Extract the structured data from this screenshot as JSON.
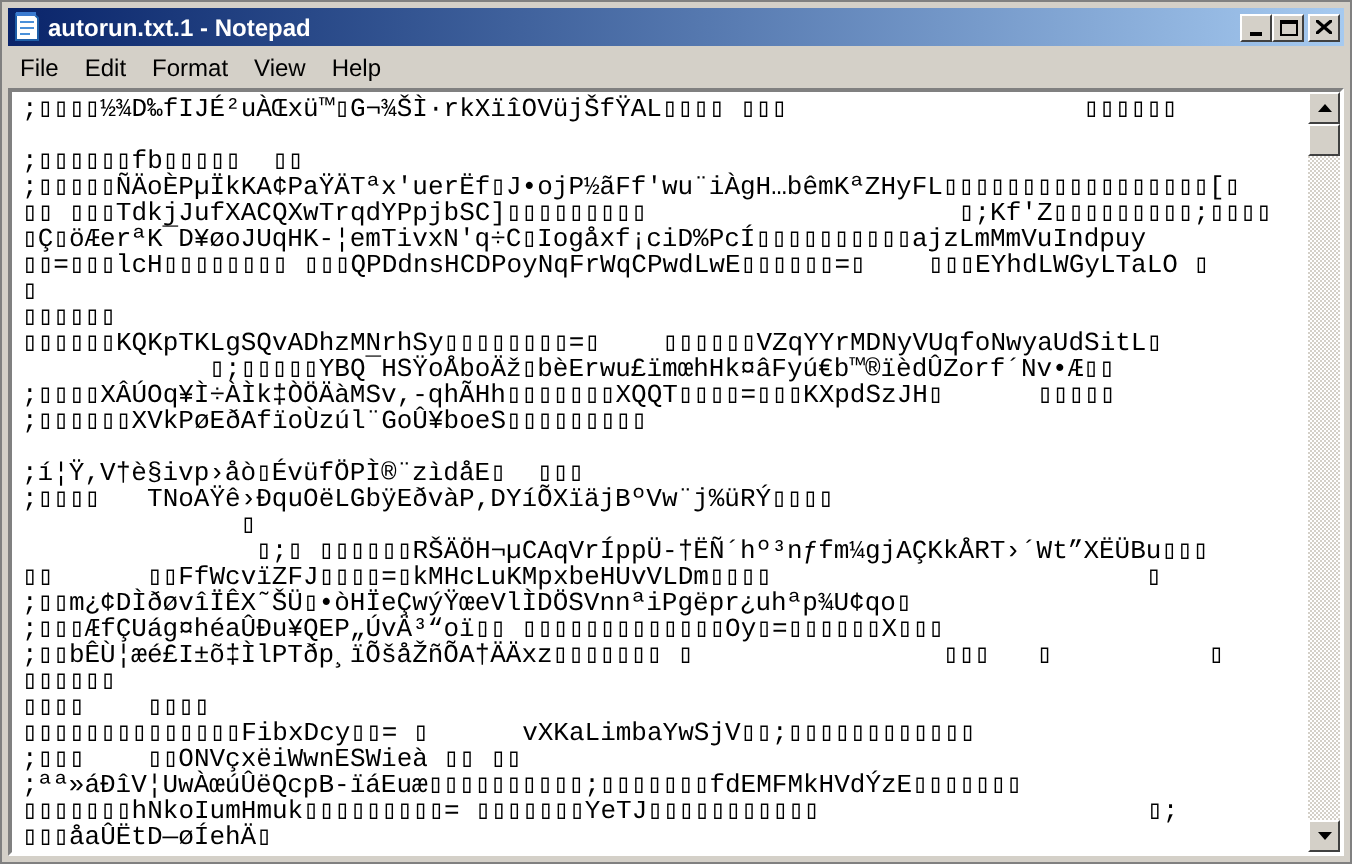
{
  "window": {
    "title": "autorun.txt.1 - Notepad"
  },
  "menu": [
    "File",
    "Edit",
    "Format",
    "View",
    "Help"
  ],
  "document": {
    "blocks": [
      [
        ";▯▯▯▯½¾D‰fIJÉ²uÀŒxü™▯G¬¾ŠÌ·rkXïîOVüjŠfŸAL▯▯▯▯ ▯▯▯                   ▯▯▯▯▯▯"
      ],
      [
        ";▯▯▯▯▯▯fb▯▯▯▯▯  ▯▯",
        ";▯▯▯▯▯ÑÄoÈPµÏkKA¢PaŸÄTªx'uerËf▯J•ojP½ãFf'wu¨iÀgH…bêmKªZHyFL▯▯▯▯▯▯▯▯▯▯▯▯▯▯▯▯▯[▯",
        "▯▯ ▯▯▯TdkjJufXACQXwTrqdYPpjbSC]▯▯▯▯▯▯▯▯▯                    ▯;Kf'Z▯▯▯▯▯▯▯▯▯;▯▯▯▯",
        "▯Ç▯öÆerªK¯D¥øoJUqHK-¦emTivxN'q÷C▯Iogåxf¡ciD%PcÍ▯▯▯▯▯▯▯▯▯▯ajzLmMmVuIndpuy",
        "▯▯=▯▯▯lcH▯▯▯▯▯▯▯▯ ▯▯▯QPDdnsHCDPoyNqFrWqCPwdLwE▯▯▯▯▯▯=▯    ▯▯▯EYhdLWGyLTaLO ▯",
        "▯",
        "▯▯▯▯▯▯",
        "▯▯▯▯▯▯KQKpTKLgSQvADhzMNrhSy▯▯▯▯▯▯▯▯=▯    ▯▯▯▯▯▯VZqYYrMDNyVUqfoNwyaUdSitL▯",
        "            ▯;▯▯▯▯▯YBQ¯HSŸoÅboÄž▯bèErwu£ïmœhHk¤âFyú€b™®ïèdÛZorf´Nv•Æ▯▯",
        ";▯▯▯▯XÂÚOq¥Ì÷ÀÌk‡ÒÖÄàMSv,-qhÃHh▯▯▯▯▯▯▯XQQT▯▯▯▯=▯▯▯KXpdSzJH▯      ▯▯▯▯▯",
        ";▯▯▯▯▯▯XVkPøEðAfïoÙzúl¨GoÛ¥boeS▯▯▯▯▯▯▯▯▯"
      ],
      [
        ";í¦Ÿ,V†è§ivp›åò▯ÉvüfÖPÌ®¨zìdåE▯  ▯▯▯",
        ";▯▯▯▯   TNoAŸê›ÐquOëLGbÿEðvàP,DYíÕXïäjBºVw¨j%üRÝ▯▯▯▯",
        "              ▯",
        "               ▯;▯ ▯▯▯▯▯▯RŠÄÖH¬µCAqVrÍppÜ-†ËÑ´hº³nƒfm¼gjAÇKkÅRT›´Wt”XËÜBu▯▯▯",
        "▯▯      ▯▯FfWcvïZFJ▯▯▯▯=▯kMHcLuKMpxbeHUvVLDm▯▯▯▯                        ▯",
        ";▯▯m¿¢DÌðøvîÏÊX˜ŠÜ▯•òHÏeÇwýŸœeVlÌDÖSVnnªiPgëpr¿uhªp¾U¢qo▯",
        ";▯▯▯ÆfÇUág¤héaÛÐu¥QEP„ÚvÄ³“oï▯▯ ▯▯▯▯▯▯▯▯▯▯▯▯▯Oy▯=▯▯▯▯▯▯X▯▯▯",
        ";▯▯bÊÙ¦æé£I±õ‡ÌlPTðp¸ïÕšåŽñÕA†ÄÄxz▯▯▯▯▯▯▯ ▯                ▯▯▯   ▯          ▯",
        "▯▯▯▯▯▯",
        "▯▯▯▯    ▯▯▯▯",
        "▯▯▯▯▯▯▯▯▯▯▯▯▯▯FibxDcy▯▯= ▯      vXKaLimbaYwSjV▯▯;▯▯▯▯▯▯▯▯▯▯▯▯",
        ";▯▯▯    ▯▯ONVçxëiWwnESWieà ▯▯ ▯▯",
        ";ªª»áÐîV¦UwÀœúÛëQcpB-ïáEuæ▯▯▯▯▯▯▯▯▯▯;▯▯▯▯▯▯▯fdEMFMkHVdÝzE▯▯▯▯▯▯▯",
        "▯▯▯▯▯▯▯hNkoIumHmuk▯▯▯▯▯▯▯▯▯= ▯▯▯▯▯▯▯YeTJ▯▯▯▯▯▯▯▯▯▯▯                     ▯;",
        "▯▯▯åaÛËtD—øÍehÄ▯"
      ]
    ]
  }
}
